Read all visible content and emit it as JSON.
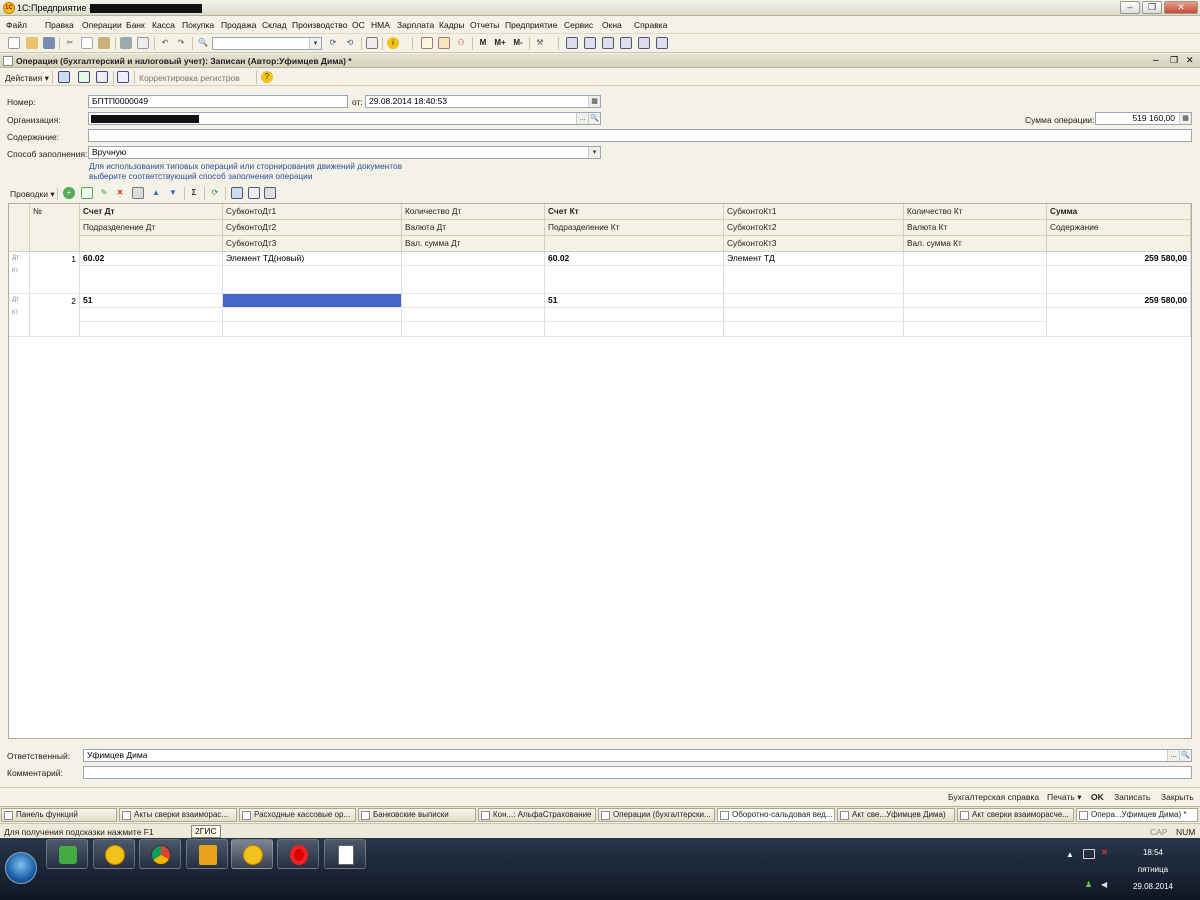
{
  "window": {
    "title": "1С:Предприятие - "
  },
  "menu": [
    "Файл",
    "Правка",
    "Операции",
    "Банк",
    "Касса",
    "Покупка",
    "Продажа",
    "Склад",
    "Производство",
    "ОС",
    "НМА",
    "Зарплата",
    "Кадры",
    "Отчеты",
    "Предприятие",
    "Сервис",
    "Окна",
    "Справка"
  ],
  "toolbar": {
    "m_label": "M",
    "mplus_label": "M+",
    "mminus_label": "M-"
  },
  "doc": {
    "title": "Операция (бухгалтерский и налоговый учет): Записан (Автор:Уфимцев Дима) *",
    "actions_label": "Действия ▾",
    "registers_label": "Корректировка регистров"
  },
  "form": {
    "number_label": "Номер:",
    "number_value": "БПТП0000049",
    "date_label": "от:",
    "date_value": "29.08.2014 18:40:53",
    "org_label": "Организация:",
    "org_value": "",
    "sum_label": "Сумма операции:",
    "sum_value": "519 160,00",
    "content_label": "Содержание:",
    "content_value": "",
    "fill_label": "Способ заполнения:",
    "fill_value": "Вручную",
    "hint_line1": "Для использования типовых операций или сторнирования движений документов",
    "hint_line2": "выберите соответствующий способ заполнения операции"
  },
  "entries": {
    "menu_label": "Проводки ▾",
    "headers": {
      "num": "№",
      "r1": [
        "Счет Дт",
        "СубконтоДт1",
        "Количество Дт",
        "Счет Кт",
        "СубконтоКт1",
        "Количество Кт",
        "Сумма"
      ],
      "r2": [
        "Подразделение Дт",
        "СубконтоДт2",
        "Валюта Дт",
        "Подразделение Кт",
        "СубконтоКт2",
        "Валюта Кт",
        "Содержание"
      ],
      "r3": [
        "",
        "СубконтоДт3",
        "Вал. сумма Дт",
        "",
        "СубконтоКт3",
        "Вал. сумма Кт",
        ""
      ]
    },
    "rows": [
      {
        "num": "1",
        "acc_dt": "60.02",
        "sub_dt1": "Элемент ТД(новый)",
        "acc_kt": "60.02",
        "sub_kt1": "Элемент ТД",
        "sum": "259 580,00"
      },
      {
        "num": "2",
        "acc_dt": "51",
        "sub_dt1": "",
        "acc_kt": "51",
        "sub_kt1": "",
        "sum": "259 580,00"
      }
    ]
  },
  "footer": {
    "responsible_label": "Ответственный:",
    "responsible_value": "Уфимцев Дима",
    "comment_label": "Комментарий:",
    "comment_value": "",
    "buttons": [
      "Бухгалтерская справка",
      "Печать ▾",
      "OK",
      "Записать",
      "Закрыть"
    ]
  },
  "tabs": [
    "Панель функций",
    "Акты сверки взаиморас...",
    "Расходные кассовые ор...",
    "Банковские выписки",
    "Кон...: АльфаСтрахование",
    "Операции (бухгалтерски...",
    "Оборотно-сальдовая вед...",
    "Акт све...Уфимцев Дима)",
    "Акт сверки взаиморасче...",
    "Опера...Уфимцев Дима) *"
  ],
  "status": {
    "hint": "Для получения подсказки нажмите F1",
    "tooltip": "2ГИС",
    "cap": "CAP",
    "num": "NUM"
  },
  "tray": {
    "time": "18:54",
    "day": "пятница",
    "date": "29.08.2014"
  },
  "colors": {
    "selection": "#4866c8",
    "hint_link": "#2a4fa0",
    "chrome": "#f4f1e6"
  }
}
